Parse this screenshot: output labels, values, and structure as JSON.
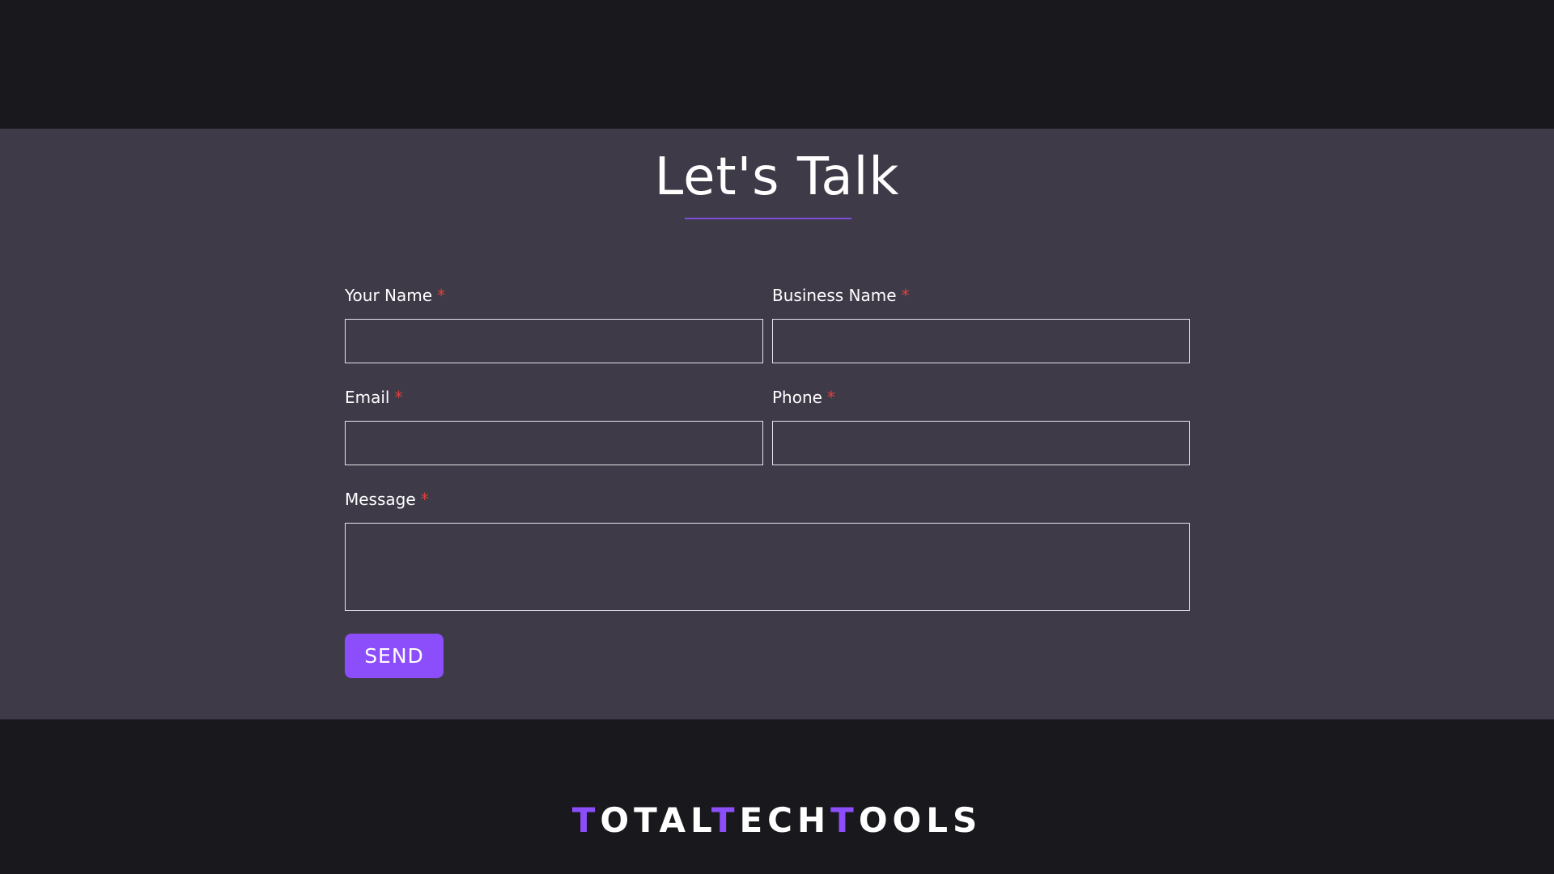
{
  "contact": {
    "title": "Let's Talk",
    "fields": {
      "your_name": {
        "label": "Your Name",
        "required_mark": "*",
        "value": ""
      },
      "business_name": {
        "label": "Business Name",
        "required_mark": "*",
        "value": ""
      },
      "email": {
        "label": "Email",
        "required_mark": "*",
        "value": ""
      },
      "phone": {
        "label": "Phone",
        "required_mark": "*",
        "value": ""
      },
      "message": {
        "label": "Message",
        "required_mark": "*",
        "value": ""
      }
    },
    "send_label": "SEND"
  },
  "footer": {
    "logo_parts": [
      "T",
      "OTAL",
      "T",
      "ECH",
      "T",
      "OOLS"
    ]
  },
  "colors": {
    "accent": "#8c4dfa",
    "required": "#e0423b",
    "section_bg": "#3e3a48",
    "page_bg": "#19181c"
  }
}
